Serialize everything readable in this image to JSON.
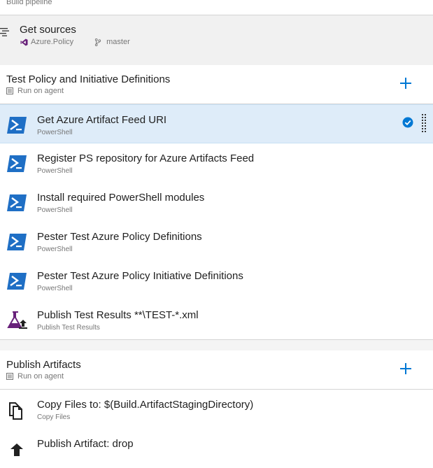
{
  "header": {
    "label": "Build pipeline"
  },
  "get_sources": {
    "title": "Get sources",
    "repository": "Azure.Policy",
    "branch": "master",
    "icon": "source-control-icon"
  },
  "phases": [
    {
      "title": "Test Policy and Initiative Definitions",
      "subtitle": "Run on agent",
      "tasks": [
        {
          "name": "Get Azure Artifact Feed URI",
          "type": "PowerShell",
          "icon": "powershell-icon",
          "selected": true
        },
        {
          "name": "Register PS repository for Azure Artifacts Feed",
          "type": "PowerShell",
          "icon": "powershell-icon"
        },
        {
          "name": "Install required PowerShell modules",
          "type": "PowerShell",
          "icon": "powershell-icon"
        },
        {
          "name": "Pester Test Azure Policy Definitions",
          "type": "PowerShell",
          "icon": "powershell-icon"
        },
        {
          "name": "Pester Test Azure Policy Initiative Definitions",
          "type": "PowerShell",
          "icon": "powershell-icon"
        },
        {
          "name": "Publish Test Results **\\TEST-*.xml",
          "type": "Publish Test Results",
          "icon": "flask-upload-icon"
        }
      ]
    },
    {
      "title": "Publish Artifacts",
      "subtitle": "Run on agent",
      "tasks": [
        {
          "name": "Copy Files to: $(Build.ArtifactStagingDirectory)",
          "type": "Copy Files",
          "icon": "copy-files-icon"
        },
        {
          "name": "Publish Artifact: drop",
          "type": "",
          "icon": "upload-icon"
        }
      ]
    }
  ],
  "colors": {
    "accent": "#0078d4",
    "selected_bg": "#deecf9",
    "powershell_blue": "#1f6fc5",
    "flask_purple": "#68217a"
  }
}
